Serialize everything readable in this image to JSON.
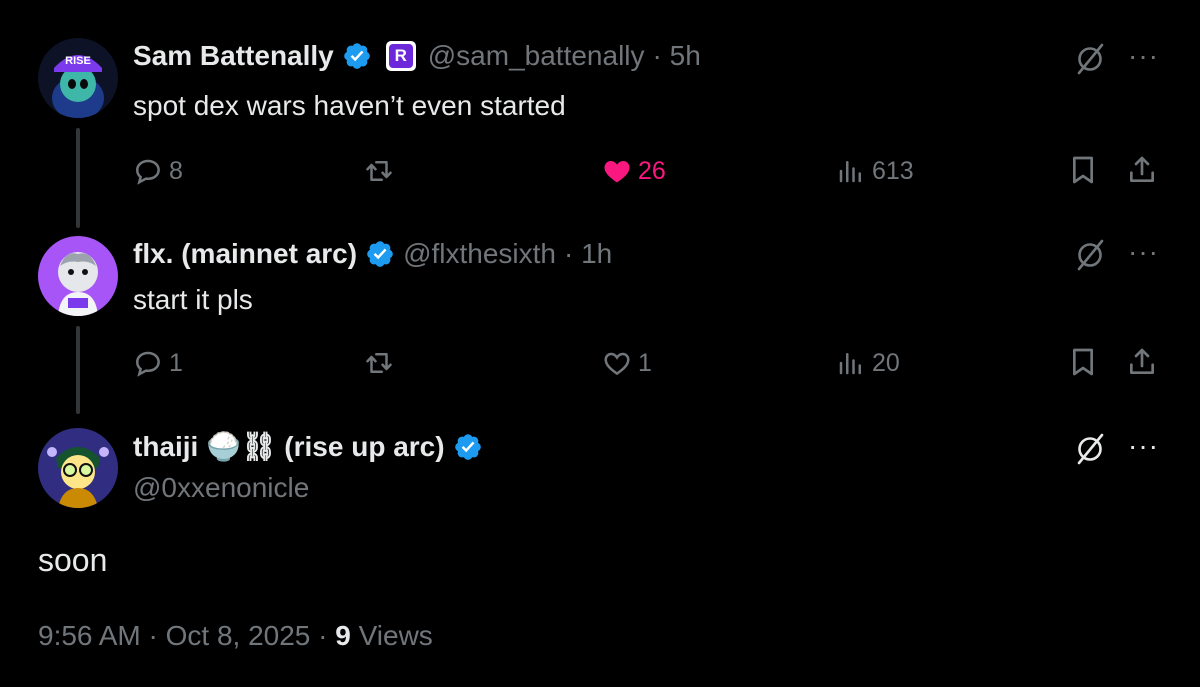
{
  "tweet1": {
    "name": "Sam Battenally",
    "handle": "@sam_battenally",
    "time": "· 5h",
    "text": "spot dex wars haven’t even started",
    "replies": "8",
    "likes": "26",
    "views": "613",
    "avatar_cap_text": "RISE",
    "affiliate_badge": "R"
  },
  "tweet2": {
    "name": "flx. (mainnet arc)",
    "handle": "@flxthesixth",
    "time": "· 1h",
    "text": "start it pls",
    "replies": "1",
    "likes": "1",
    "views": "20"
  },
  "tweet3": {
    "name": "thaiji 🍚⛓ (rise up arc)",
    "handle": "@0xxenonicle",
    "text": "soon",
    "time": "9:56 AM · Oct 8, 2025 ·",
    "views_count": "9",
    "views_label": "Views"
  },
  "icons": {
    "reply": "reply-icon",
    "retweet": "retweet-icon",
    "like": "heart-icon",
    "views": "views-icon",
    "bookmark": "bookmark-icon",
    "share": "share-icon",
    "grok": "grok-icon",
    "more": "more-icon",
    "verified": "verified-badge-icon"
  },
  "colors": {
    "background": "#000000",
    "text": "#e7e9ea",
    "muted": "#71767b",
    "like": "#f91880",
    "verified": "#1d9bf0"
  }
}
